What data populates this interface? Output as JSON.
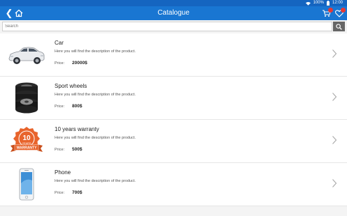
{
  "status": {
    "battery": "100%",
    "time": "12:00"
  },
  "appbar": {
    "title": "Catalogue"
  },
  "search": {
    "placeholder": "Search",
    "value": ""
  },
  "products": [
    {
      "name": "Car",
      "description": "Here you will find the description of the product.",
      "price_label": "Price:",
      "price": "20000$",
      "icon": "car-icon"
    },
    {
      "name": "Sport wheels",
      "description": "Here you will find the description of the product.",
      "price_label": "Price:",
      "price": "800$",
      "icon": "tires-icon"
    },
    {
      "name": "10 years warranty",
      "description": "Here you will find the description of the product.",
      "price_label": "Price:",
      "price": "500$",
      "icon": "warranty-badge-icon",
      "badge": {
        "number": "10",
        "years": "YEARS",
        "ribbon": "WARRANTY"
      }
    },
    {
      "name": "Phone",
      "description": "Here you will find the description of the product.",
      "price_label": "Price:",
      "price": "700$",
      "icon": "phone-icon"
    }
  ],
  "colors": {
    "appbar": "#1976d2",
    "statusbar": "#1565c0",
    "badge": "#e53935",
    "warranty": "#e8642c"
  }
}
